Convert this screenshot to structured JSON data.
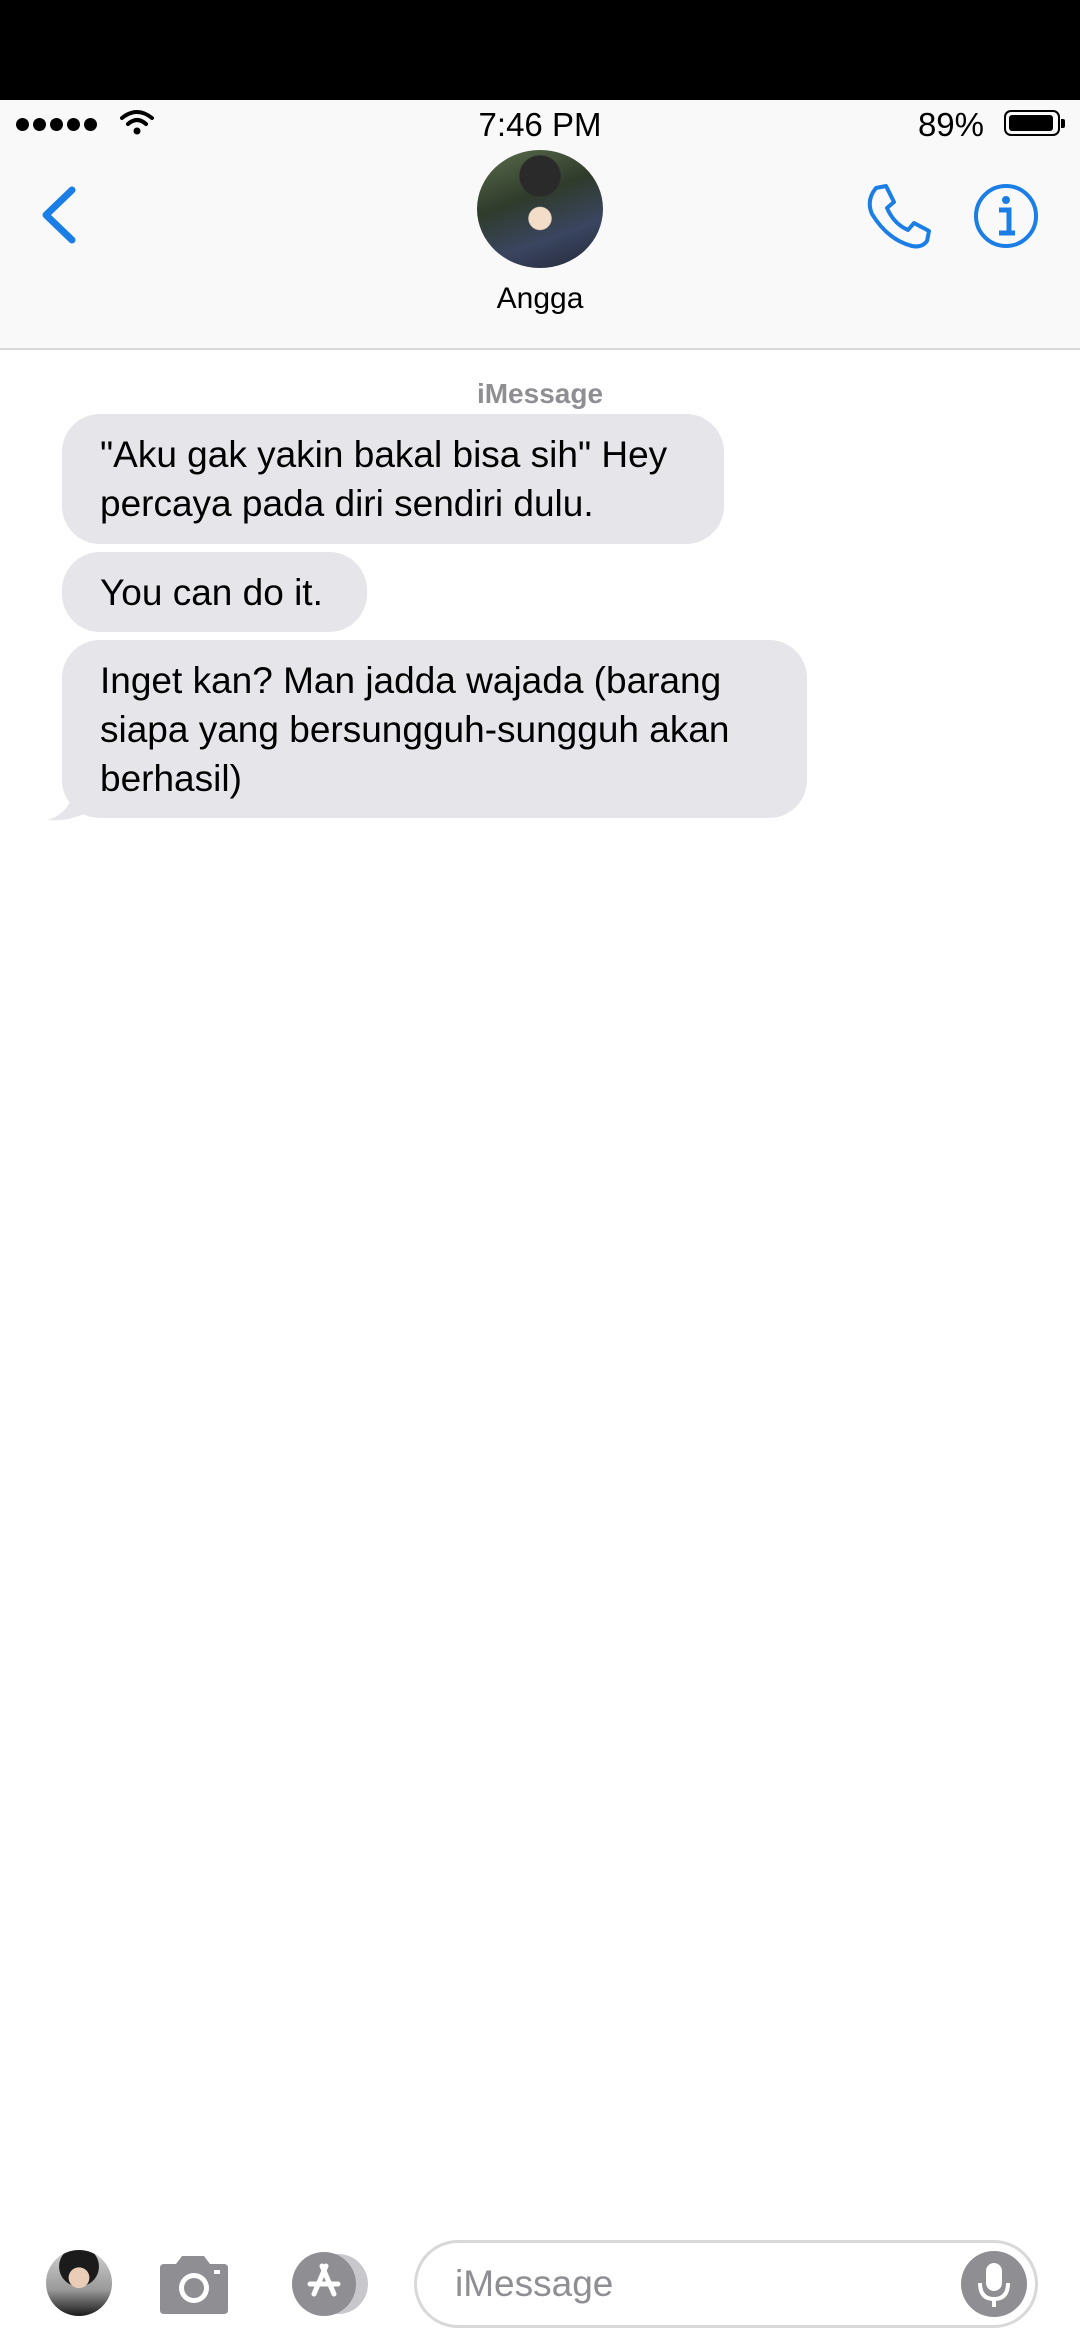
{
  "status_bar": {
    "time": "7:46 PM",
    "battery_percent": "89%",
    "signal_bars": 5
  },
  "header": {
    "contact_name": "Angga",
    "back_icon": "chevron-left-icon",
    "call_icon": "phone-icon",
    "info_icon": "info-icon"
  },
  "conversation": {
    "service_label": "iMessage",
    "messages": [
      {
        "text": "\"Aku gak yakin bakal bisa sih\" Hey percaya pada diri sendiri dulu."
      },
      {
        "text": "You can do it."
      },
      {
        "text": "Inget kan? Man jadda wajada (barang siapa yang bersungguh-sungguh akan berhasil)"
      }
    ]
  },
  "input_bar": {
    "placeholder": "iMessage",
    "camera_icon": "camera-icon",
    "appstore_icon": "app-store-icon",
    "mic_icon": "microphone-icon"
  },
  "colors": {
    "accent": "#1a7ee6",
    "received_bubble": "#e5e5ea",
    "secondary_text": "#8e8e93"
  }
}
